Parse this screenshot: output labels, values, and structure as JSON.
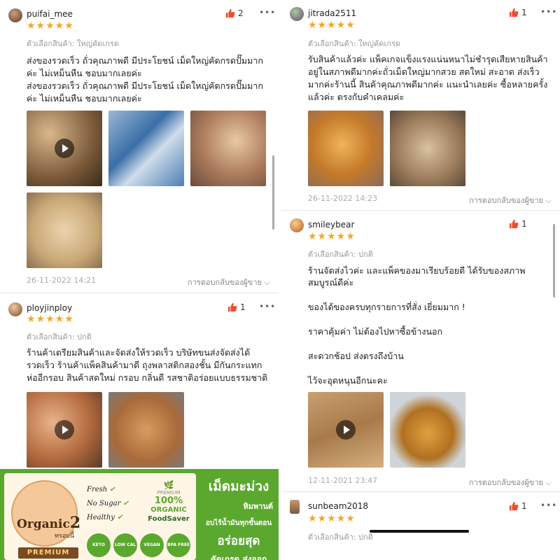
{
  "reviews": [
    {
      "user": "puifai_mee",
      "likes": "2",
      "rating": "★★★★★",
      "variant": "ตัวเลือกสินค้า: ใหญ่คัดเกรด",
      "text": [
        "ส่งของรวดเร็ว ถั่วคุณภาพดี มีประโยชน์ เม็ดใหญ่คัดกรดปั๊มมาก",
        "ค่ะ ไม่เหม็นหืน ชอบมากเลยค่ะ",
        "ส่งของรวดเร็ว ถั่วคุณภาพดี มีประโยชน์ เม็ดใหญ่คัดกรดปั๊มมาก",
        "ค่ะ ไม่เหม็นหืน ชอบมากเลยค่ะ"
      ],
      "date": "26-11-2022 14:21",
      "seller_reply": "การตอบกลับของผู้ขาย"
    },
    {
      "user": "ployjinploy",
      "likes": "1",
      "rating": "★★★★★",
      "variant": "ตัวเลือกสินค้า: ปกติ",
      "text": [
        "ร้านค้าเตรียมสินค้าและจัดส่งให้รวดเร็ว บริษัทขนส่งจัดส่งได้",
        "รวดเร็ว ร้านค้าแพ็คสินค้ามาดี ถุงพลาสติกสองชั้น มีกันกระแทก",
        "ห่ออีกรอบ สินค้าสดใหม่ กรอบ กลิ่นดี รสชาติอร่อยแบบธรรมชาติ"
      ]
    },
    {
      "user": "jitrada2511",
      "likes": "1",
      "rating": "★★★★★",
      "variant": "ตัวเลือกสินค้า: ใหญ่คัดเกรด",
      "text": [
        "รับสินค้าแล้วค่ะ แพ็คเกจแข็งแรงแน่นหนาไม่ชำรุดเสียหายสินค้า",
        "อยู่ในสภาพดีมากค่ะถั่วเม็ดใหญ่มากสวย สดใหม่ สะอาด ส่งเร็ว",
        "มากค่ะร้านนี้ สินค้าคุณภาพดีมากค่ะ แนะนำเลยค่ะ ซื้อหลายครั้ง",
        "แล้วค่ะ ตรงกับคำเคลมค่ะ"
      ],
      "date": "26-11-2022 14:23",
      "seller_reply": "การตอบกลับของผู้ขาย"
    },
    {
      "user": "smileybear",
      "likes": "1",
      "rating": "★★★★★",
      "variant": "ตัวเลือกสินค้า: ปกติ",
      "text": [
        "ร้านจัดส่งไวค่ะ และแพ็คของมาเรียบร้อยดี ได้รับของสภาพ",
        "สมบูรณ์ดีค่ะ",
        "",
        "ของได้ของครบทุกรายการที่สั่ง เยี่ยมมาก !",
        "",
        "ราคาคุ้มค่า ไม่ต้องไปหาซื้อข้างนอก",
        "",
        "สะดวกช้อป  ส่งตรงถึงบ้าน",
        "",
        "ไว้จะอุดหนุนอีกนะคะ"
      ],
      "date": "12-11-2021 23:47",
      "seller_reply": "การตอบกลับของผู้ขาย"
    },
    {
      "user": "sunbeam2018",
      "likes": "1",
      "rating": "★★★★★",
      "variant": "ตัวเลือกสินค้า: ปกติ"
    }
  ],
  "ad": {
    "brand": "Organic",
    "brand_num": "2",
    "brand_sub": "ทรอบนี้",
    "premium": "PREMIUM",
    "checks": [
      "Fresh",
      "No Sugar",
      "Healthy"
    ],
    "premium_small": "PREMIUM",
    "organic_pct": "100%",
    "organic_word": "ORGANIC",
    "foodsaver": "FoodSaver",
    "badges": [
      "KETO DIET",
      "LOW CAL",
      "VEGAN",
      "BPA FREE"
    ],
    "headline": "เม็ดมะม่วง",
    "subhead": "หิมพานต์",
    "line1": "อบไร้น้ำมันทุกขั้นตอน",
    "line2": "อร่อยสุด",
    "line3": "คัดเกรด ส่งออก"
  },
  "colors": {
    "star": "#f5a623",
    "like": "#ee4d2d",
    "ad_green": "#5aa82e"
  }
}
